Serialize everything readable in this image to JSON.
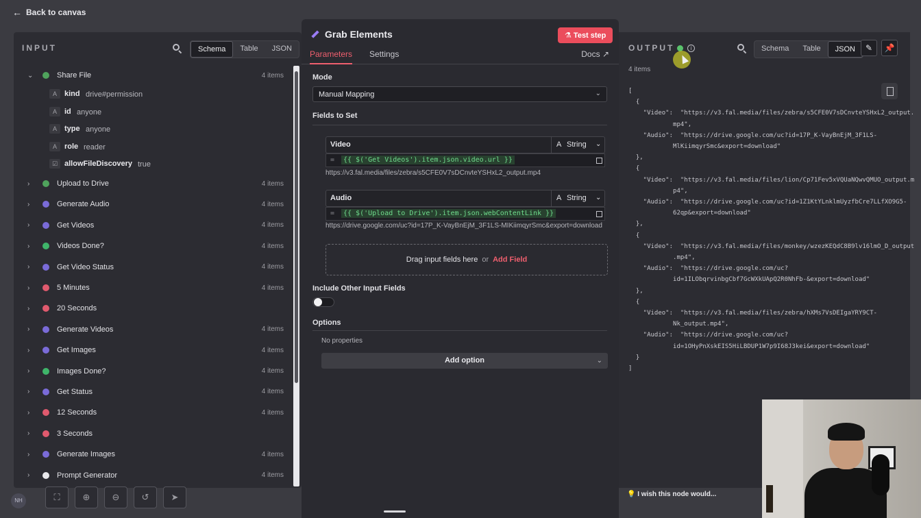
{
  "nav": {
    "back_label": "Back to canvas"
  },
  "input": {
    "header": "INPUT",
    "view_tabs": [
      "Schema",
      "Table",
      "JSON"
    ],
    "active_view": "Schema",
    "tree": [
      {
        "label": "Share File",
        "count": "4 items",
        "expanded": true,
        "icon_color": "#4fa35c",
        "children": [
          {
            "type": "A",
            "key": "kind",
            "value": "drive#permission"
          },
          {
            "type": "A",
            "key": "id",
            "value": "anyone"
          },
          {
            "type": "A",
            "key": "type",
            "value": "anyone"
          },
          {
            "type": "A",
            "key": "role",
            "value": "reader"
          },
          {
            "type": "☑",
            "key": "allowFileDiscovery",
            "value": "true"
          }
        ]
      },
      {
        "label": "Upload to Drive",
        "count": "4 items",
        "icon_color": "#4fa35c"
      },
      {
        "label": "Generate Audio",
        "count": "4 items",
        "icon_color": "#7a6bd8"
      },
      {
        "label": "Get Videos",
        "count": "4 items",
        "icon_color": "#7a6bd8"
      },
      {
        "label": "Videos Done?",
        "count": "4 items",
        "icon_color": "#3fb56a"
      },
      {
        "label": "Get Video Status",
        "count": "4 items",
        "icon_color": "#7a6bd8"
      },
      {
        "label": "5 Minutes",
        "count": "4 items",
        "icon_color": "#e05a6e"
      },
      {
        "label": "20 Seconds",
        "count": "",
        "icon_color": "#e05a6e"
      },
      {
        "label": "Generate Videos",
        "count": "4 items",
        "icon_color": "#7a6bd8"
      },
      {
        "label": "Get Images",
        "count": "4 items",
        "icon_color": "#7a6bd8"
      },
      {
        "label": "Images Done?",
        "count": "4 items",
        "icon_color": "#3fb56a"
      },
      {
        "label": "Get Status",
        "count": "4 items",
        "icon_color": "#7a6bd8"
      },
      {
        "label": "12 Seconds",
        "count": "4 items",
        "icon_color": "#e05a6e"
      },
      {
        "label": "3 Seconds",
        "count": "",
        "icon_color": "#e05a6e"
      },
      {
        "label": "Generate Images",
        "count": "4 items",
        "icon_color": "#7a6bd8"
      },
      {
        "label": "Prompt Generator",
        "count": "4 items",
        "icon_color": "#e8e8ec"
      }
    ]
  },
  "node": {
    "title": "Grab Elements",
    "test_button": "Test step",
    "tabs": [
      "Parameters",
      "Settings"
    ],
    "docs": "Docs",
    "mode_label": "Mode",
    "mode_value": "Manual Mapping",
    "fields_label": "Fields to Set",
    "fields": [
      {
        "name": "Video",
        "type": "String",
        "expression": "{{ $('Get Videos').item.json.video.url }}",
        "resolved": "https://v3.fal.media/files/zebra/s5CFE0V7sDCnvteYSHxL2_output.mp4"
      },
      {
        "name": "Audio",
        "type": "String",
        "expression": "{{ $('Upload to Drive').item.json.webContentLink }}",
        "resolved": "https://drive.google.com/uc?id=17P_K-VayBnEjM_3F1LS-MIKiimqyrSmc&export=download"
      }
    ],
    "drop_text": "Drag input fields here",
    "drop_or": "or",
    "add_field": "Add Field",
    "include_label": "Include Other Input Fields",
    "options_label": "Options",
    "no_props": "No properties",
    "add_option": "Add option"
  },
  "output": {
    "header": "OUTPUT",
    "items_count": "4 items",
    "view_tabs": [
      "Schema",
      "Table",
      "JSON"
    ],
    "active_view": "JSON",
    "json_lines": [
      "[",
      "  {",
      "    \"Video\":  \"https://v3.fal.media/files/zebra/s5CFE0V7sDCnvteYSHxL2_output.",
      "            mp4\",",
      "    \"Audio\":  \"https://drive.google.com/uc?id=17P_K-VayBnEjM_3F1LS-",
      "            MlKiimqyrSmc&export=download\"",
      "  },",
      "  {",
      "    \"Video\":  \"https://v3.fal.media/files/lion/Cp71Fev5xVQUaNQwvQMUO_output.m",
      "            p4\",",
      "    \"Audio\":  \"https://drive.google.com/uc?id=1Z1KtYLnklmUyzfbCre7LLfXO9G5-",
      "            62qp&export=download\"",
      "  },",
      "  {",
      "    \"Video\":  \"https://v3.fal.media/files/monkey/wzezKEQdC8B9lv16lmO_D_output",
      "            .mp4\",",
      "    \"Audio\":  \"https://drive.google.com/uc?",
      "            id=1ILObqrvinbgCbf7GcWXkUApQ2R0NhFb-&export=download\"",
      "  },",
      "  {",
      "    \"Video\":  \"https://v3.fal.media/files/zebra/hXMs7VsDEIgaYRY9CT-",
      "            Nk_output.mp4\",",
      "    \"Audio\":  \"https://drive.google.com/uc?",
      "            id=1OHyPnXskEIS5HiLBDUP1W7p9I68J3kei&export=download\"",
      "  }",
      "]"
    ]
  },
  "footer": {
    "wish": "I wish this node would...",
    "avatar": "NH"
  }
}
